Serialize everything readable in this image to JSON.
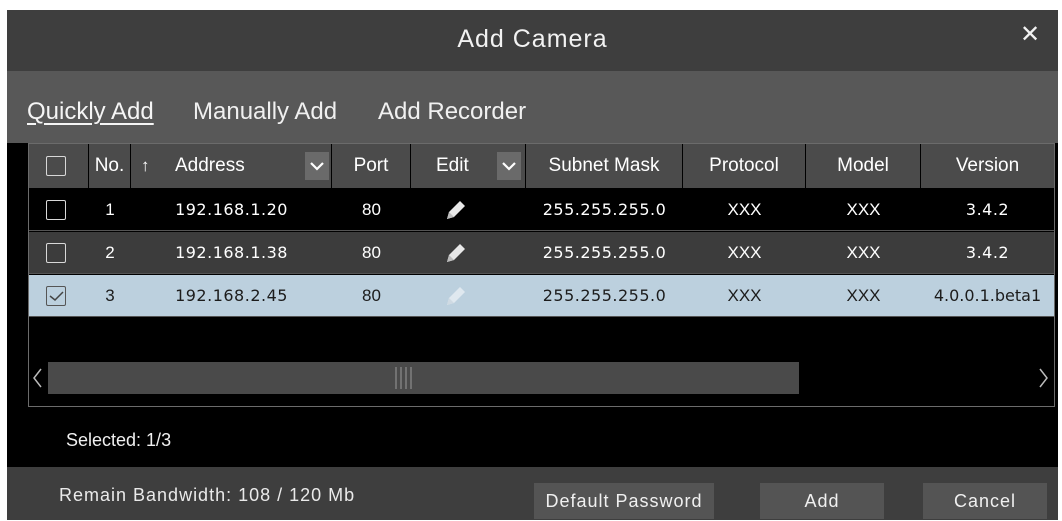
{
  "dialog": {
    "title": "Add Camera",
    "close_icon": "close-icon"
  },
  "tabs": [
    {
      "label": "Quickly Add",
      "active": true
    },
    {
      "label": "Manually Add",
      "active": false
    },
    {
      "label": "Add Recorder",
      "active": false
    }
  ],
  "table": {
    "headers": {
      "no": "No.",
      "address": "Address",
      "address_sort_icon": "↑",
      "port": "Port",
      "edit": "Edit",
      "subnet": "Subnet Mask",
      "protocol": "Protocol",
      "model": "Model",
      "version": "Version"
    },
    "rows": [
      {
        "no": "1",
        "address": "192.168.1.20",
        "port": "80",
        "subnet": "255.255.255.0",
        "protocol": "XXX",
        "model": "XXX",
        "version": "3.4.2",
        "checked": false
      },
      {
        "no": "2",
        "address": "192.168.1.38",
        "port": "80",
        "subnet": "255.255.255.0",
        "protocol": "XXX",
        "model": "XXX",
        "version": "3.4.2",
        "checked": false
      },
      {
        "no": "3",
        "address": "192.168.2.45",
        "port": "80",
        "subnet": "255.255.255.0",
        "protocol": "XXX",
        "model": "XXX",
        "version": "4.0.0.1.beta1",
        "checked": true
      }
    ]
  },
  "status": {
    "selected": "Selected: 1/3"
  },
  "footer": {
    "bandwidth": "Remain Bandwidth: 108 / 120 Mb",
    "default_password": "Default Password",
    "add": "Add",
    "cancel": "Cancel"
  },
  "colors": {
    "title_bg": "#3e3e3e",
    "tabs_bg": "#585858",
    "header_bg": "#4b4b4b",
    "selected_row": "#bcd0de",
    "alt_row": "#3c3c3c"
  }
}
